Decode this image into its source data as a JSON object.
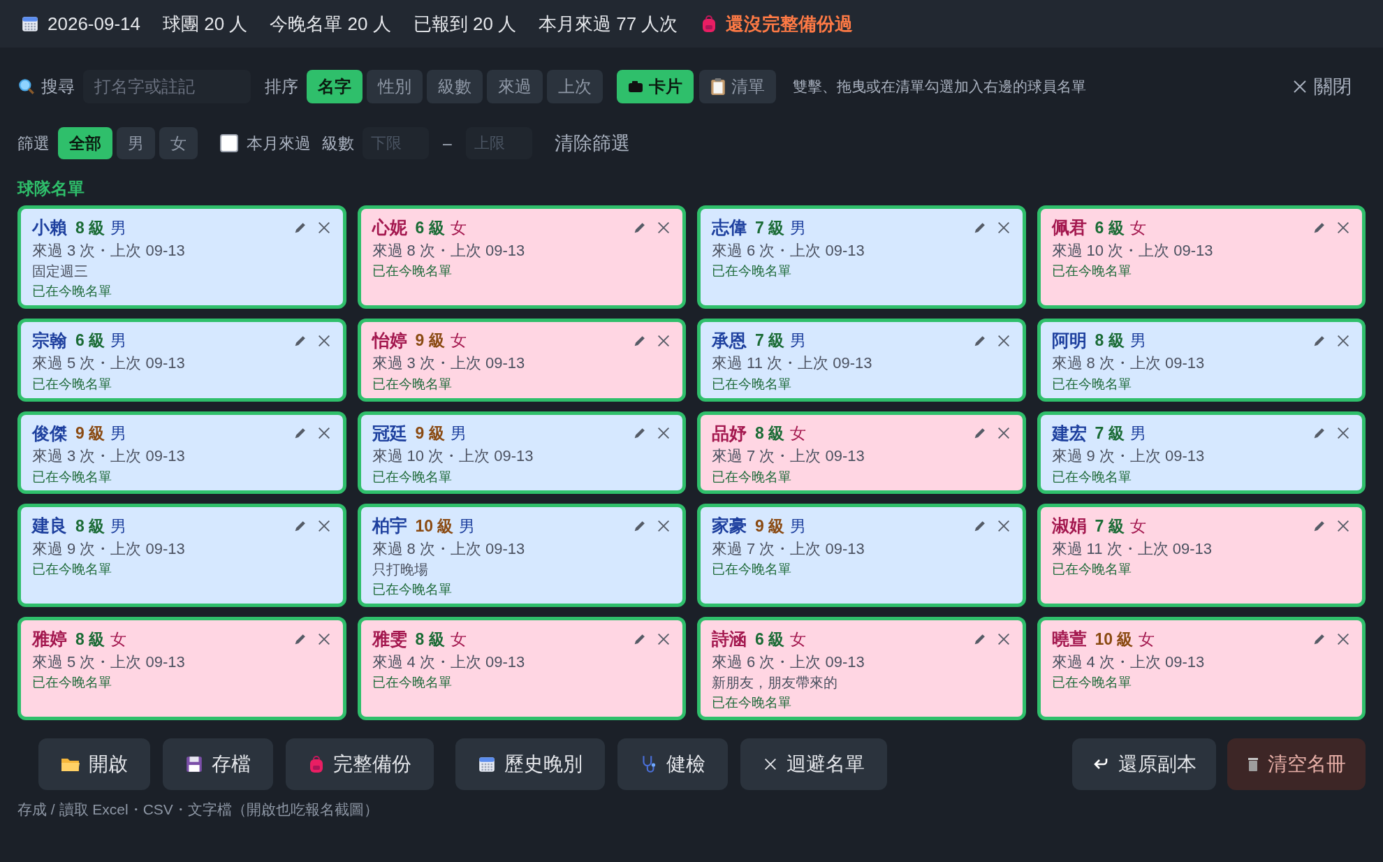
{
  "header": {
    "date": "2026-09-14",
    "stats": [
      "球團 20 人",
      "今晚名單 20 人",
      "已報到 20 人",
      "本月來過 77 人次"
    ],
    "warning": "還沒完整備份過"
  },
  "toolbar": {
    "search_label": "搜尋",
    "search": {
      "placeholder": "打名字或註記"
    },
    "sort_label": "排序",
    "sort_options": [
      {
        "label": "名字",
        "selected": true
      },
      {
        "label": "性別",
        "selected": false
      },
      {
        "label": "級數",
        "selected": false
      },
      {
        "label": "來過",
        "selected": false
      },
      {
        "label": "上次",
        "selected": false
      }
    ],
    "views": [
      {
        "label": "卡片",
        "selected": true,
        "kind": "card"
      },
      {
        "label": "清單",
        "selected": false,
        "kind": "list"
      }
    ],
    "hint": "雙擊、拖曳或在清單勾選加入右邊的球員名單",
    "close": "關閉"
  },
  "filters": {
    "label": "篩選",
    "genders": [
      {
        "label": "全部",
        "selected": true
      },
      {
        "label": "男",
        "selected": false
      },
      {
        "label": "女",
        "selected": false
      }
    ],
    "this_month": {
      "label": "本月來過",
      "checked": false
    },
    "level_label": "級數",
    "level_min": {
      "placeholder": "下限"
    },
    "dash": "–",
    "level_max": {
      "placeholder": "上限"
    },
    "clear": "清除篩選"
  },
  "roster": {
    "title": "球隊名單",
    "players": [
      {
        "name": "小賴",
        "level": "8 級",
        "color": "#1a6b35",
        "gender": "男",
        "kind": "male",
        "visits": "來過 3 次・上次 09-13",
        "note": "固定週三",
        "status": "已在今晚名單"
      },
      {
        "name": "心妮",
        "level": "6 級",
        "color": "#1a6b35",
        "gender": "女",
        "kind": "female",
        "visits": "來過 8 次・上次 09-13",
        "status": "已在今晚名單"
      },
      {
        "name": "志偉",
        "level": "7 級",
        "color": "#1a6b35",
        "gender": "男",
        "kind": "male",
        "visits": "來過 6 次・上次 09-13",
        "status": "已在今晚名單"
      },
      {
        "name": "佩君",
        "level": "6 級",
        "color": "#1a6b35",
        "gender": "女",
        "kind": "female",
        "visits": "來過 10 次・上次 09-13",
        "status": "已在今晚名單"
      },
      {
        "name": "宗翰",
        "level": "6 級",
        "color": "#1a6b35",
        "gender": "男",
        "kind": "male",
        "visits": "來過 5 次・上次 09-13",
        "status": "已在今晚名單"
      },
      {
        "name": "怡婷",
        "level": "9 級",
        "color": "#8a4a12",
        "gender": "女",
        "kind": "female",
        "visits": "來過 3 次・上次 09-13",
        "status": "已在今晚名單"
      },
      {
        "name": "承恩",
        "level": "7 級",
        "color": "#1a6b35",
        "gender": "男",
        "kind": "male",
        "visits": "來過 11 次・上次 09-13",
        "status": "已在今晚名單"
      },
      {
        "name": "阿明",
        "level": "8 級",
        "color": "#1a6b35",
        "gender": "男",
        "kind": "male",
        "visits": "來過 8 次・上次 09-13",
        "status": "已在今晚名單"
      },
      {
        "name": "俊傑",
        "level": "9 級",
        "color": "#8a4a12",
        "gender": "男",
        "kind": "male",
        "visits": "來過 3 次・上次 09-13",
        "status": "已在今晚名單"
      },
      {
        "name": "冠廷",
        "level": "9 級",
        "color": "#8a4a12",
        "gender": "男",
        "kind": "male",
        "visits": "來過 10 次・上次 09-13",
        "status": "已在今晚名單"
      },
      {
        "name": "品妤",
        "level": "8 級",
        "color": "#1a6b35",
        "gender": "女",
        "kind": "female",
        "visits": "來過 7 次・上次 09-13",
        "status": "已在今晚名單"
      },
      {
        "name": "建宏",
        "level": "7 級",
        "color": "#1a6b35",
        "gender": "男",
        "kind": "male",
        "visits": "來過 9 次・上次 09-13",
        "status": "已在今晚名單"
      },
      {
        "name": "建良",
        "level": "8 級",
        "color": "#1a6b35",
        "gender": "男",
        "kind": "male",
        "visits": "來過 9 次・上次 09-13",
        "status": "已在今晚名單"
      },
      {
        "name": "柏宇",
        "level": "10 級",
        "color": "#8a4a12",
        "gender": "男",
        "kind": "male",
        "visits": "來過 8 次・上次 09-13",
        "note": "只打晚場",
        "status": "已在今晚名單"
      },
      {
        "name": "家豪",
        "level": "9 級",
        "color": "#8a4a12",
        "gender": "男",
        "kind": "male",
        "visits": "來過 7 次・上次 09-13",
        "status": "已在今晚名單"
      },
      {
        "name": "淑娟",
        "level": "7 級",
        "color": "#1a6b35",
        "gender": "女",
        "kind": "female",
        "visits": "來過 11 次・上次 09-13",
        "status": "已在今晚名單"
      },
      {
        "name": "雅婷",
        "level": "8 級",
        "color": "#1a6b35",
        "gender": "女",
        "kind": "female",
        "visits": "來過 5 次・上次 09-13",
        "status": "已在今晚名單"
      },
      {
        "name": "雅雯",
        "level": "8 級",
        "color": "#1a6b35",
        "gender": "女",
        "kind": "female",
        "visits": "來過 4 次・上次 09-13",
        "status": "已在今晚名單"
      },
      {
        "name": "詩涵",
        "level": "6 級",
        "color": "#1a6b35",
        "gender": "女",
        "kind": "female",
        "visits": "來過 6 次・上次 09-13",
        "note": "新朋友，朋友帶來的",
        "status": "已在今晚名單"
      },
      {
        "name": "曉萱",
        "level": "10 級",
        "color": "#8a4a12",
        "gender": "女",
        "kind": "female",
        "visits": "來過 4 次・上次 09-13",
        "status": "已在今晚名單"
      }
    ]
  },
  "actions": [
    {
      "label": "開啟",
      "kind": "folder"
    },
    {
      "label": "存檔",
      "kind": "disk"
    },
    {
      "label": "完整備份",
      "kind": "backpack"
    },
    {
      "label": "歷史晚別",
      "kind": "calendar"
    },
    {
      "label": "健檢",
      "kind": "stethoscope"
    },
    {
      "label": "迴避名單",
      "kind": "cross"
    }
  ],
  "right_actions": [
    {
      "label": "還原副本",
      "kind": "undo"
    },
    {
      "label": "清空名冊",
      "kind": "trash"
    }
  ],
  "footer": "存成 / 讀取 Excel・CSV・文字檔（開啟也吃報名截圖）"
}
